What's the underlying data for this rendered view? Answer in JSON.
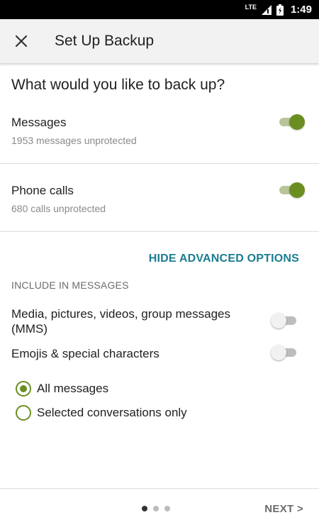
{
  "status_bar": {
    "network": "LTE",
    "time": "1:49"
  },
  "app_bar": {
    "close_icon": "close-icon",
    "title": "Set Up Backup"
  },
  "question": "What would you like to back up?",
  "items": [
    {
      "title": "Messages",
      "subtitle": "1953 messages unprotected",
      "enabled": true
    },
    {
      "title": "Phone calls",
      "subtitle": "680 calls unprotected",
      "enabled": true
    }
  ],
  "advanced_toggle": "HIDE ADVANCED OPTIONS",
  "include_section": {
    "label": "INCLUDE IN MESSAGES",
    "options": [
      {
        "title": "Media, pictures, videos, group messages (MMS)",
        "enabled": false
      },
      {
        "title": "Emojis & special characters",
        "enabled": false
      }
    ]
  },
  "scope": {
    "options": [
      "All messages",
      "Selected conversations only"
    ],
    "selected": "All messages"
  },
  "footer": {
    "pages": 3,
    "current_page": 1,
    "next_label": "NEXT >"
  },
  "colors": {
    "accent": "#6b8e23",
    "link": "#1a7d8f"
  }
}
